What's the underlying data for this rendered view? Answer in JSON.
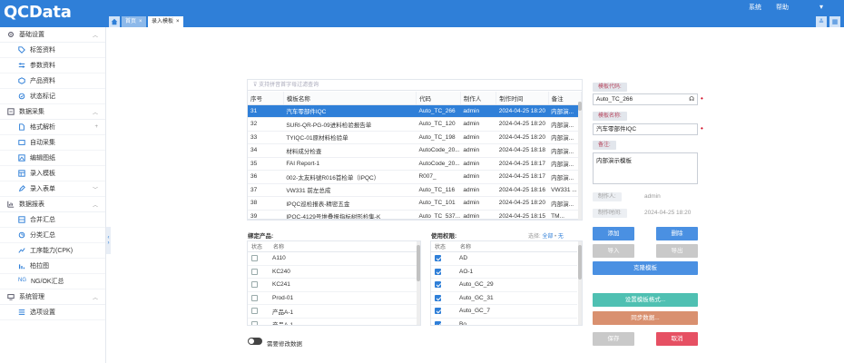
{
  "app": {
    "logo": "QCData",
    "nav_system": "系统",
    "nav_help": "帮助"
  },
  "tabs": [
    {
      "label": "首页"
    },
    {
      "label": "录入模板"
    }
  ],
  "sidebar": {
    "groups": [
      {
        "label": "基础设置",
        "items": [
          {
            "label": "标签资料"
          },
          {
            "label": "参数资料"
          },
          {
            "label": "产品资料"
          },
          {
            "label": "状态标记"
          }
        ]
      },
      {
        "label": "数据采集",
        "items": [
          {
            "label": "格式解析"
          },
          {
            "label": "自动采集"
          },
          {
            "label": "编辑图纸"
          },
          {
            "label": "录入模板"
          },
          {
            "label": "录入表单"
          }
        ]
      },
      {
        "label": "数据报表",
        "items": [
          {
            "label": "合并汇总"
          },
          {
            "label": "分类汇总"
          },
          {
            "label": "工序能力(CPK)"
          },
          {
            "label": "柏拉图"
          },
          {
            "label": "NG/OK汇总"
          }
        ]
      },
      {
        "label": "系统管理",
        "items": [
          {
            "label": "选项设置"
          }
        ]
      }
    ]
  },
  "grid": {
    "search_placeholder": "支持拼音首字母过滤查询",
    "columns": [
      "序号",
      "模板名称",
      "代码",
      "制作人",
      "制作时间",
      "备注"
    ],
    "rows": [
      [
        "31",
        "汽车零部件IQC",
        "Auto_TC_266",
        "admin",
        "2024-04-25 18:20",
        "内部演..."
      ],
      [
        "32",
        "SURI-QR-PG-09进料检验报告单",
        "Auto_TC_120",
        "admin",
        "2024-04-25 18:20",
        "内部演..."
      ],
      [
        "33",
        "TYIQC-01原材料检验单",
        "Auto_TC_198",
        "admin",
        "2024-04-25 18:20",
        "内部演..."
      ],
      [
        "34",
        "材料成分检查",
        "AutoCode_20...",
        "admin",
        "2024-04-25 18:18",
        "内部演..."
      ],
      [
        "35",
        "FAI Report-1",
        "AutoCode_20...",
        "admin",
        "2024-04-25 18:17",
        "内部演..."
      ],
      [
        "36",
        "002-太友料號R016首检单（IPQC）",
        "R007_",
        "admin",
        "2024-04-25 18:17",
        "内部演..."
      ],
      [
        "37",
        "VW331 前左总成",
        "Auto_TC_116",
        "admin",
        "2024-04-25 18:16",
        "VW331 ..."
      ],
      [
        "38",
        "IPQC巡检报表-精密五金",
        "Auto_TC_101",
        "admin",
        "2024-04-25 18:20",
        "内部演..."
      ],
      [
        "39",
        "IPQC-4129号堆叠报指标树形检集-K",
        "Auto_TC_537...",
        "admin",
        "2024-04-25 18:15",
        "TM..."
      ]
    ]
  },
  "products": {
    "title": "绑定产品:",
    "col_state": "状态",
    "col_name": "名称",
    "items": [
      "A110",
      "KC240",
      "KC241",
      "Prod-01",
      "产品A-1",
      "产品A-1"
    ]
  },
  "permissions": {
    "title": "使用权限:",
    "select_label": "选择:",
    "select_all": "全部",
    "select_none": "无",
    "col_state": "状态",
    "col_name": "名称",
    "items": [
      "AD",
      "AO-1",
      "Auto_GC_29",
      "Auto_GC_31",
      "Auto_GC_7",
      "Bo"
    ]
  },
  "toggle_label": "需要修改数据",
  "form": {
    "code_label": "模板代码:",
    "code_value": "Auto_TC_266",
    "name_label": "模板名称:",
    "name_value": "汽车零部件IQC",
    "remark_label": "备注:",
    "remark_value": "内部演示模板",
    "maker_label": "制作人:",
    "maker_value": "admin",
    "time_label": "制作时间:",
    "time_value": "2024-04-25 18:20"
  },
  "buttons": {
    "add": "添加",
    "delete": "删除",
    "import": "导入",
    "export": "导出",
    "clone": "克隆模板",
    "format": "设置模板格式...",
    "sync": "同步数据...",
    "save": "保存",
    "cancel": "取消"
  },
  "colors": {
    "brand": "#2f7fd8",
    "accent_teal": "#4fc0b2",
    "accent_orange": "#d9906f",
    "danger": "#e65063"
  }
}
